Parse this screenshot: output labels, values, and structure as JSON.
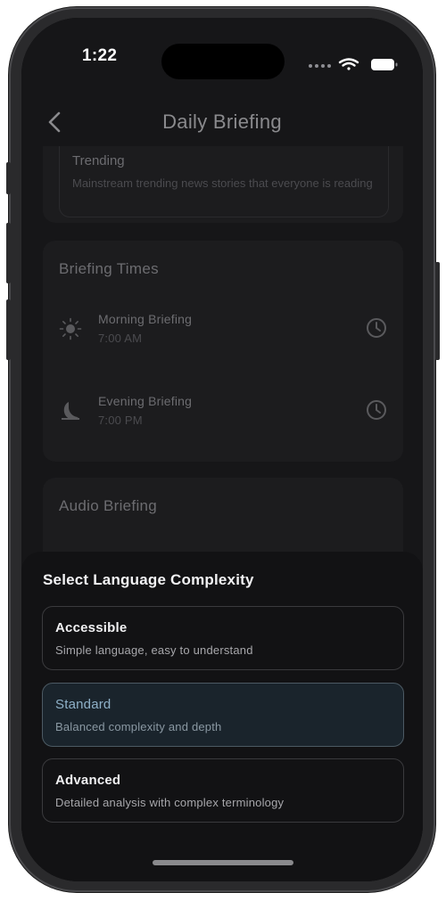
{
  "status_bar": {
    "time": "1:22"
  },
  "header": {
    "title": "Daily Briefing",
    "back_icon": "chevron-left-icon"
  },
  "trending": {
    "title": "Trending",
    "description": "Mainstream trending news stories that everyone is reading"
  },
  "briefing_times": {
    "title": "Briefing Times",
    "items": [
      {
        "label": "Morning Briefing",
        "time": "7:00 AM",
        "icon": "sun-icon"
      },
      {
        "label": "Evening Briefing",
        "time": "7:00 PM",
        "icon": "moon-icon"
      }
    ]
  },
  "audio_briefing": {
    "title": "Audio Briefing"
  },
  "sheet": {
    "title": "Select Language Complexity",
    "options": [
      {
        "name": "Accessible",
        "description": "Simple language, easy to understand",
        "selected": false
      },
      {
        "name": "Standard",
        "description": "Balanced complexity and depth",
        "selected": true
      },
      {
        "name": "Advanced",
        "description": "Detailed analysis with complex terminology",
        "selected": false
      }
    ]
  },
  "colors": {
    "background": "#161618",
    "card": "#1c1c1e",
    "selected_accent": "#8fb1c8",
    "sheet": "#121214"
  }
}
